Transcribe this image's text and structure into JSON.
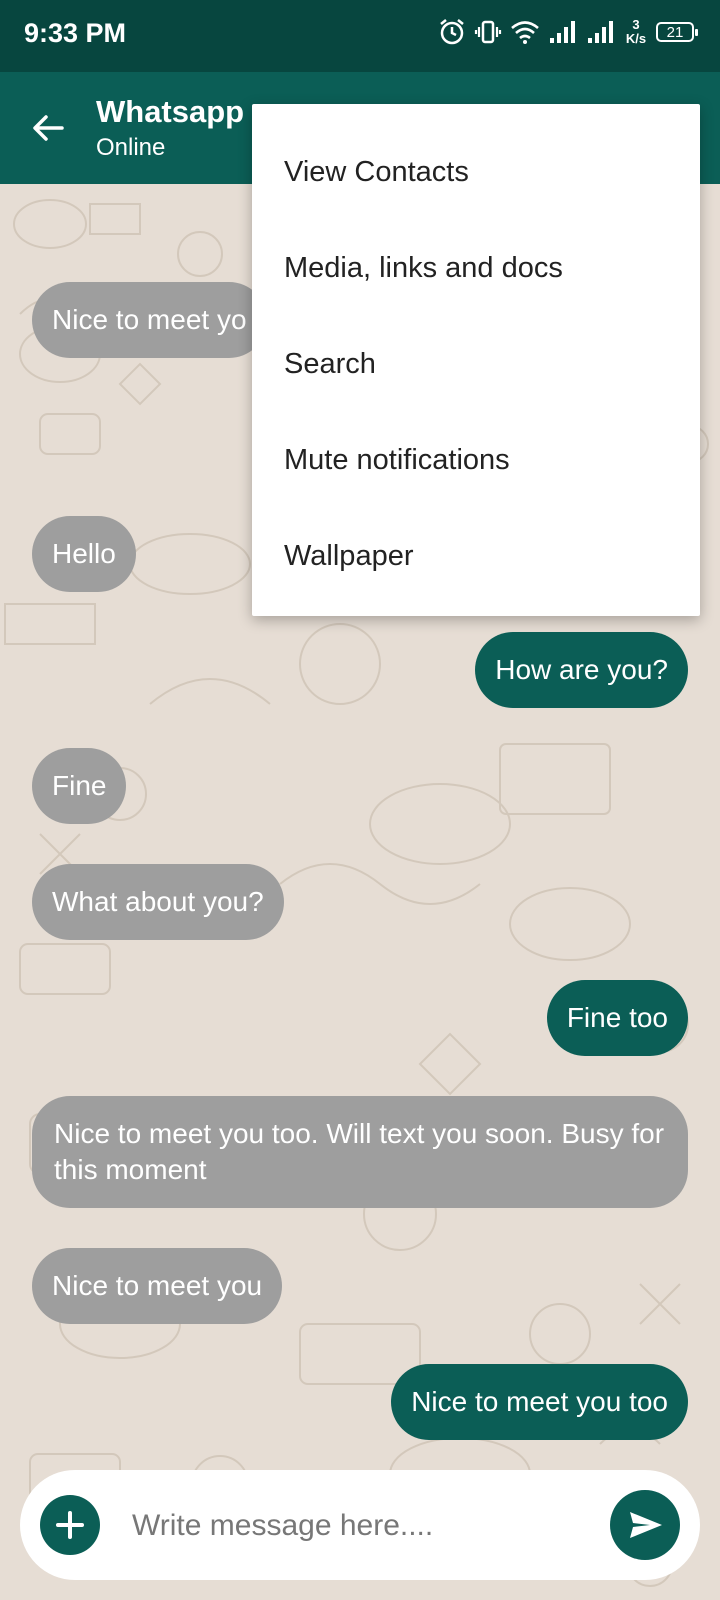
{
  "status": {
    "time": "9:33 PM",
    "speed_value": "3",
    "speed_unit": "K/s",
    "battery": "21"
  },
  "header": {
    "title": "Whatsapp u",
    "subtitle": "Online"
  },
  "messages": [
    {
      "text": "Nice to meet yo",
      "side": "in"
    },
    {
      "text": "Hello",
      "side": "in"
    },
    {
      "text": "How are you?",
      "side": "out"
    },
    {
      "text": "Fine",
      "side": "in"
    },
    {
      "text": "What about you?",
      "side": "in"
    },
    {
      "text": "Fine too",
      "side": "out"
    },
    {
      "text": "Nice to meet you too. Will text you soon. Busy for this moment",
      "side": "in"
    },
    {
      "text": "Nice to meet you",
      "side": "in"
    },
    {
      "text": "Nice to meet you too",
      "side": "out"
    }
  ],
  "menu": {
    "items": [
      "View Contacts",
      "Media, links and docs",
      "Search",
      "Mute notifications",
      "Wallpaper"
    ]
  },
  "composer": {
    "placeholder": "Write message here....",
    "value": ""
  },
  "colors": {
    "status_bar": "#07463f",
    "app_bar": "#0b5e56",
    "outgoing_bubble": "#0b5e56",
    "incoming_bubble": "#9e9e9e",
    "chat_background": "#e6ddd4"
  },
  "icons": {
    "back": "arrow-left-icon",
    "add": "plus-icon",
    "send": "send-icon",
    "alarm": "alarm-icon",
    "vibrate": "vibrate-icon",
    "wifi": "wifi-icon",
    "signal": "signal-icon",
    "battery": "battery-icon"
  }
}
